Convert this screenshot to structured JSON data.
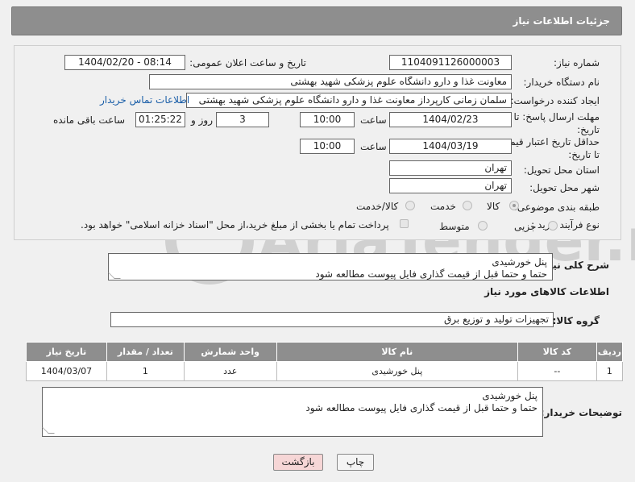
{
  "header": {
    "title": "جزئیات اطلاعات نیاز"
  },
  "form": {
    "need_number_label": "شماره نیاز:",
    "need_number": "1104091126000003",
    "announce_label": "تاریخ و ساعت اعلان عمومی:",
    "announce_value": "1404/02/20 - 08:14",
    "buyer_org_label": "نام دستگاه خریدار:",
    "buyer_org": "معاونت غذا و دارو دانشگاه علوم پزشکی شهید بهشتی",
    "creator_label": "ایجاد کننده درخواست:",
    "creator": "سلمان زمانی کارپرداز معاونت غذا و دارو دانشگاه علوم پزشکی شهید بهشتی",
    "contact_link": "اطلاعات تماس خریدار",
    "reply_deadline_label": "مهلت ارسال پاسخ: تا تاریخ:",
    "reply_date": "1404/02/23",
    "time_label": "ساعت",
    "reply_time": "10:00",
    "days_value": "3",
    "days_label": "روز و",
    "remaining_value": "01:25:22",
    "remaining_label": "ساعت باقی مانده",
    "min_validity_label": "حداقل تاریخ اعتبار قیمت: تا تاریخ:",
    "validity_date": "1404/03/19",
    "validity_time": "10:00",
    "province_label": "استان محل تحویل:",
    "province": "تهران",
    "city_label": "شهر محل تحویل:",
    "city": "تهران",
    "category_label": "طبقه بندی موضوعی:",
    "category_options": [
      "کالا",
      "خدمت",
      "کالا/خدمت"
    ],
    "category_selected": "کالا",
    "process_label": "نوع فرآیند خرید :",
    "process_options": [
      "جزیی",
      "متوسط"
    ],
    "payment_note": "پرداخت تمام یا بخشی از مبلغ خرید،از محل \"اسناد خزانه اسلامی\" خواهد بود."
  },
  "summary": {
    "label": "شرح کلی نیاز:",
    "text": "پنل خورشیدی\nحتما و حتما قبل از قیمت گذاری فایل پیوست مطالعه شود"
  },
  "goods": {
    "section_title": "اطلاعات کالاهای مورد نیاز",
    "group_label": "گروه کالا:",
    "group_value": "تجهیزات تولید و توزیع برق",
    "columns": [
      "ردیف",
      "کد کالا",
      "نام کالا",
      "واحد شمارش",
      "تعداد / مقدار",
      "تاریخ نیاز"
    ],
    "rows": [
      {
        "index": "1",
        "code": "--",
        "name": "پنل خورشیدی",
        "unit": "عدد",
        "qty": "1",
        "date": "1404/03/07"
      }
    ]
  },
  "buyer_notes": {
    "label": "توضیحات خریدار:",
    "text": "پنل خورشیدی\nحتما و حتما قبل از قیمت گذاری فایل پیوست مطالعه شود"
  },
  "buttons": {
    "print": "چاپ",
    "back": "بازگشت"
  },
  "watermark": {
    "text": "AriaTender.net"
  },
  "colors": {
    "header_bg": "#8e8e8e",
    "link": "#1a5ea8",
    "back_button_bg": "#f6d6d6"
  }
}
